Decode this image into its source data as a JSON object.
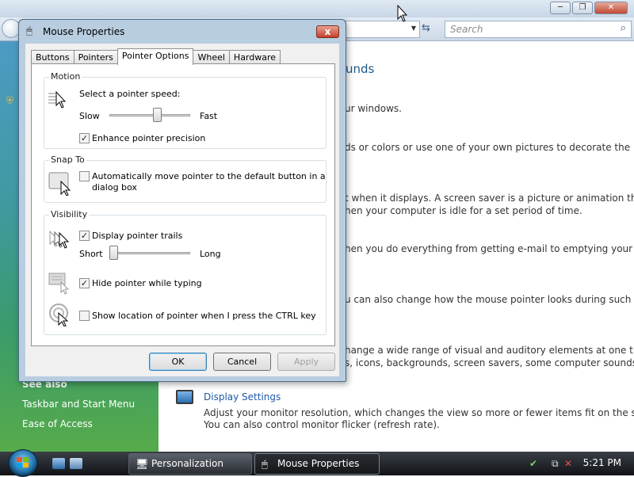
{
  "background_window": {
    "search_placeholder": "Search",
    "main": {
      "heading_fragment": "unds",
      "lines": [
        "ur windows.",
        "ds or colors or use one of your own pictures to decorate the",
        "t when it displays. A screen saver is a picture or animation that",
        "hen your computer is idle for a set period of time.",
        "hen you do everything from getting e-mail to emptying your",
        "u can also change how the mouse pointer looks during such",
        "hange a wide range of visual and auditory elements at one time",
        "s, icons, backgrounds, screen savers, some computer sounds, and"
      ],
      "display_settings": {
        "title": "Display Settings",
        "desc1": "Adjust your monitor resolution, which changes the view so more or fewer items fit on the screen.",
        "desc2": "You can also control monitor flicker (refresh rate)."
      }
    },
    "left_pane": {
      "see_also": "See also",
      "links": [
        "Taskbar and Start Menu",
        "Ease of Access"
      ]
    }
  },
  "dialog": {
    "title": "Mouse Properties",
    "tabs": [
      "Buttons",
      "Pointers",
      "Pointer Options",
      "Wheel",
      "Hardware"
    ],
    "active_tab": "Pointer Options",
    "motion": {
      "label": "Motion",
      "speed_label": "Select a pointer speed:",
      "slow": "Slow",
      "fast": "Fast",
      "speed_value": 0.6,
      "precision_label": "Enhance pointer precision",
      "precision_checked": true
    },
    "snap_to": {
      "label": "Snap To",
      "line1": "Automatically move pointer to the default button in a",
      "line2": "dialog box",
      "checked": false
    },
    "visibility": {
      "label": "Visibility",
      "trails_label": "Display pointer trails",
      "trails_checked": true,
      "short": "Short",
      "long": "Long",
      "trail_value": 0.0,
      "hide_label": "Hide pointer while typing",
      "hide_checked": true,
      "ctrl_label": "Show location of pointer when I press the CTRL key",
      "ctrl_checked": false
    },
    "buttons": {
      "ok": "OK",
      "cancel": "Cancel",
      "apply": "Apply"
    },
    "check_glyph": "✓",
    "close_glyph": "x"
  },
  "taskbar": {
    "tasks": [
      {
        "label": "Personalization",
        "active": false
      },
      {
        "label": "Mouse Properties",
        "active": true
      }
    ],
    "clock": "5:21 PM"
  }
}
